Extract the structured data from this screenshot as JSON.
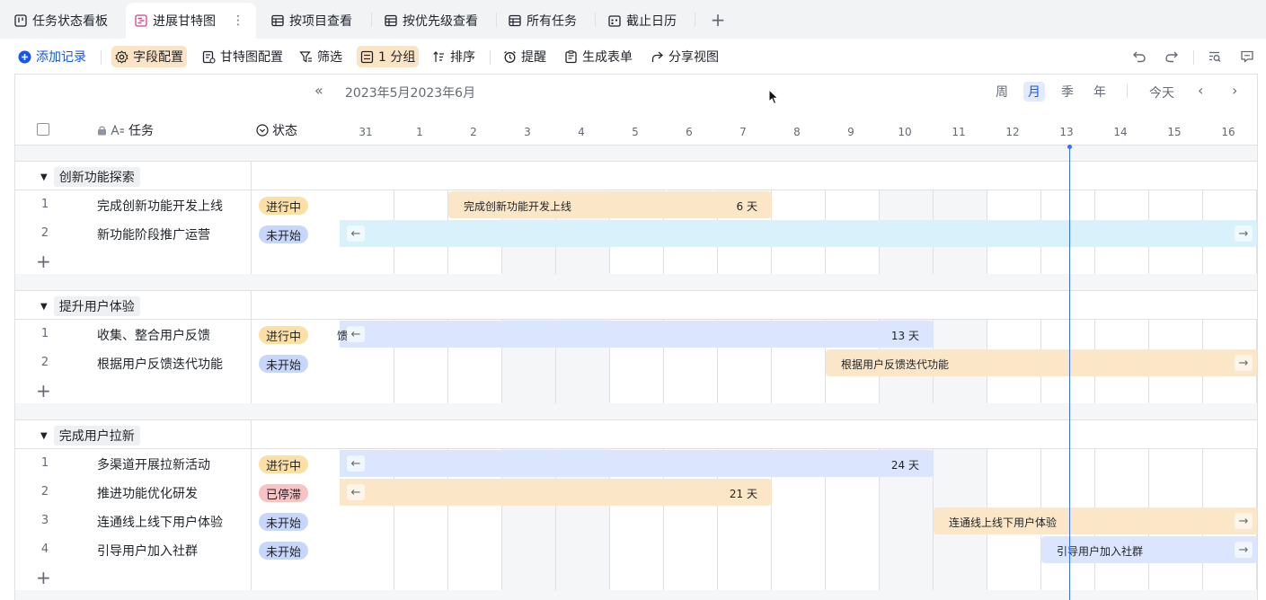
{
  "tabs": [
    {
      "label": "任务状态看板",
      "icon": "kanban-icon"
    },
    {
      "label": "进展甘特图",
      "icon": "gantt-icon",
      "active": true
    },
    {
      "label": "按项目查看",
      "icon": "table-icon"
    },
    {
      "label": "按优先级查看",
      "icon": "table-icon"
    },
    {
      "label": "所有任务",
      "icon": "table-icon"
    },
    {
      "label": "截止日历",
      "icon": "calendar-icon"
    }
  ],
  "toolbar": {
    "add_record": "添加记录",
    "field_config": "字段配置",
    "gantt_config": "甘特图配置",
    "filter": "筛选",
    "group": "1 分组",
    "sort": "排序",
    "reminder": "提醒",
    "form": "生成表单",
    "share": "分享视图"
  },
  "header": {
    "task_col": "任务",
    "status_col": "状态",
    "period": "2023年5月2023年6月",
    "scales": [
      "周",
      "月",
      "季",
      "年"
    ],
    "active_scale": "月",
    "today": "今天",
    "days": [
      "31",
      "1",
      "2",
      "3",
      "4",
      "5",
      "6",
      "7",
      "8",
      "9",
      "10",
      "11",
      "12",
      "13",
      "14",
      "15",
      "16"
    ]
  },
  "colors": {
    "accent": "#1456f0",
    "today_line": "#3370ff",
    "bar_orange": "#fbe6c8",
    "bar_blue": "#dbe5fd",
    "bar_cyan": "#d9f1fb",
    "badge_progress": "#fbe0a5",
    "badge_notstarted": "#c7d6fb",
    "badge_stalled": "#f8c4c3"
  },
  "groups": [
    {
      "name": "创新功能探索",
      "tasks": [
        {
          "num": "1",
          "title": "完成创新功能开发上线",
          "status": "进行中",
          "status_kind": "progress",
          "bar": {
            "label": "完成创新功能开发上线",
            "duration": "6 天",
            "color": "orange"
          }
        },
        {
          "num": "2",
          "title": "新功能阶段推广运营",
          "status": "未开始",
          "status_kind": "notstarted",
          "bar": {
            "label": "",
            "duration": "",
            "color": "cyan",
            "arrow_left": "←",
            "arrow_right": "→"
          }
        }
      ]
    },
    {
      "name": "提升用户体验",
      "tasks": [
        {
          "num": "1",
          "title": "收集、整合用户反馈",
          "status": "进行中",
          "status_kind": "progress",
          "bar": {
            "label": "馈",
            "duration": "13 天",
            "color": "blue",
            "arrow_left": "←"
          }
        },
        {
          "num": "2",
          "title": "根据用户反馈迭代功能",
          "status": "未开始",
          "status_kind": "notstarted",
          "bar": {
            "label": "根据用户反馈迭代功能",
            "duration": "",
            "color": "orange",
            "arrow_right": "→"
          }
        }
      ]
    },
    {
      "name": "完成用户拉新",
      "tasks": [
        {
          "num": "1",
          "title": "多渠道开展拉新活动",
          "status": "进行中",
          "status_kind": "progress",
          "bar": {
            "label": "",
            "duration": "24 天",
            "color": "blue",
            "arrow_left": "←"
          }
        },
        {
          "num": "2",
          "title": "推进功能优化研发",
          "status": "已停滞",
          "status_kind": "stalled",
          "bar": {
            "label": "",
            "duration": "21 天",
            "color": "orange",
            "arrow_left": "←"
          }
        },
        {
          "num": "3",
          "title": "连通线上线下用户体验",
          "status": "未开始",
          "status_kind": "notstarted",
          "bar": {
            "label": "连通线上线下用户体验",
            "duration": "",
            "color": "orange",
            "arrow_right": "→"
          }
        },
        {
          "num": "4",
          "title": "引导用户加入社群",
          "status": "未开始",
          "status_kind": "notstarted",
          "bar": {
            "label": "引导用户加入社群",
            "duration": "",
            "color": "blue",
            "arrow_right": "→"
          }
        }
      ]
    }
  ]
}
